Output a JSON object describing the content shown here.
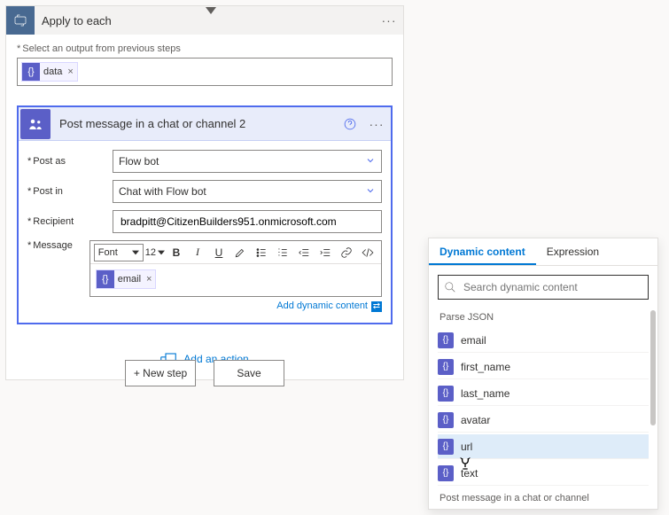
{
  "outer": {
    "title": "Apply to each"
  },
  "prevStepsLabel": "Select an output from previous steps",
  "dataToken": "data",
  "inner": {
    "title": "Post message in a chat or channel 2",
    "fields": {
      "postAsLabel": "Post as",
      "postAsValue": "Flow bot",
      "postInLabel": "Post in",
      "postInValue": "Chat with Flow bot",
      "recipientLabel": "Recipient",
      "recipientValue": "bradpitt@CitizenBuilders951.onmicrosoft.com",
      "messageLabel": "Message"
    },
    "toolbar": {
      "font": "Font",
      "size": "12"
    },
    "msgToken": "email",
    "dynLink": "Add dynamic content"
  },
  "addAction": "Add an action",
  "buttons": {
    "newStep": "+ New step",
    "save": "Save"
  },
  "dc": {
    "tabs": {
      "dynamic": "Dynamic content",
      "expression": "Expression"
    },
    "searchPlaceholder": "Search dynamic content",
    "group1": "Parse JSON",
    "items": [
      "email",
      "first_name",
      "last_name",
      "avatar",
      "url",
      "text"
    ],
    "group2": "Post message in a chat or channel"
  }
}
